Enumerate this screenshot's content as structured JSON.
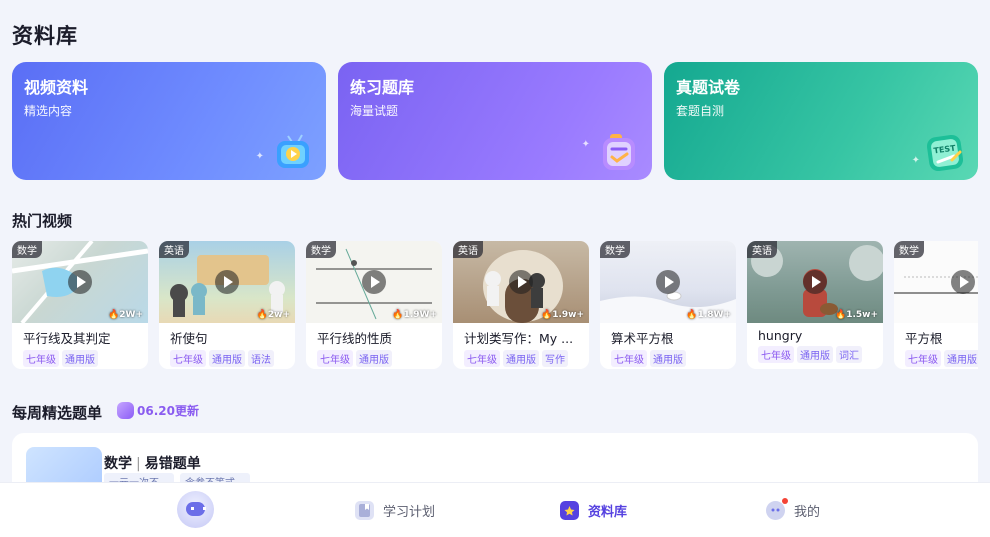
{
  "page_title": "资料库",
  "cards": [
    {
      "title": "视频资料",
      "subtitle": "精选内容",
      "icon": "tv-play-icon"
    },
    {
      "title": "练习题库",
      "subtitle": "海量试题",
      "icon": "checklist-icon"
    },
    {
      "title": "真题试卷",
      "subtitle": "套题自测",
      "icon": "test-paper-icon",
      "icon_text": "TEST"
    }
  ],
  "hot_videos": {
    "title": "热门视频",
    "items": [
      {
        "tag": "数学",
        "views": "2W+",
        "title": "平行线及其判定",
        "chips": [
          "七年级",
          "通用版"
        ]
      },
      {
        "tag": "英语",
        "views": "2w+",
        "title": "祈使句",
        "chips": [
          "七年级",
          "通用版",
          "语法"
        ]
      },
      {
        "tag": "数学",
        "views": "1.9W+",
        "title": "平行线的性质",
        "chips": [
          "七年级",
          "通用版"
        ]
      },
      {
        "tag": "英语",
        "views": "1.9w+",
        "title": "计划类写作：My ...",
        "chips": [
          "七年级",
          "通用版",
          "写作"
        ]
      },
      {
        "tag": "数学",
        "views": "1.8W+",
        "title": "算术平方根",
        "chips": [
          "七年级",
          "通用版"
        ]
      },
      {
        "tag": "英语",
        "views": "1.5w+",
        "title": "hungry",
        "chips": [
          "七年级",
          "通用版",
          "词汇"
        ]
      },
      {
        "tag": "数学",
        "views": "",
        "title": "平方根",
        "chips": [
          "七年级",
          "通用版"
        ]
      }
    ]
  },
  "weekly": {
    "title": "每周精选题单",
    "badge": "06.20更新",
    "card": {
      "subject": "数学",
      "separator": "|",
      "name": "易错题单",
      "chips": [
        "一元一次不…",
        "含参不等式…"
      ]
    }
  },
  "tabbar": {
    "items": [
      {
        "label": "",
        "icon": "home-assistant-icon"
      },
      {
        "label": "学习计划",
        "icon": "plan-icon"
      },
      {
        "label": "资料库",
        "icon": "library-icon",
        "active": true
      },
      {
        "label": "我的",
        "icon": "profile-icon",
        "has_dot": true
      }
    ]
  },
  "colors": {
    "accent": "#5541e0",
    "purple_chip": "#8c5bf0",
    "card1": "#6f8cff",
    "card2": "#9a7bff",
    "card3": "#37c5a4"
  }
}
